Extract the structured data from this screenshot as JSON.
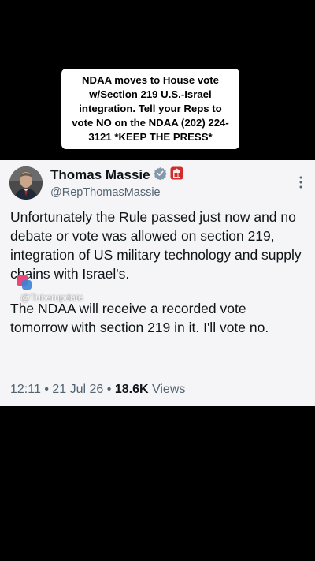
{
  "caption": {
    "text": "NDAA moves to House vote w/Section 219 U.S.-Israel integration. Tell your Reps to vote NO on the NDAA (202) 224-3121 *KEEP THE PRESS*"
  },
  "tweet": {
    "author_name": "Thomas Massie",
    "handle": "@RepThomasMassie",
    "paragraphs": [
      "Unfortunately the Rule passed just now and no debate or vote was allowed on section 219, integration of US military technology and supply chains with Israel's.",
      "The NDAA will receive a recorded vote tomorrow with section 219 in it. I'll vote no."
    ],
    "time": "12:11",
    "date": "21 Jul 26",
    "views_count": "18.6K",
    "views_label": "Views",
    "separator": "•"
  },
  "watermark": {
    "text": "@Tuberupdate"
  },
  "colors": {
    "verified_badge": "#829aab",
    "government_badge": "#d12b2b",
    "secondary_text": "#536471"
  },
  "icons": [
    "verified-badge-icon",
    "government-badge-icon",
    "more-options-icon",
    "watermark-logo-icon"
  ]
}
